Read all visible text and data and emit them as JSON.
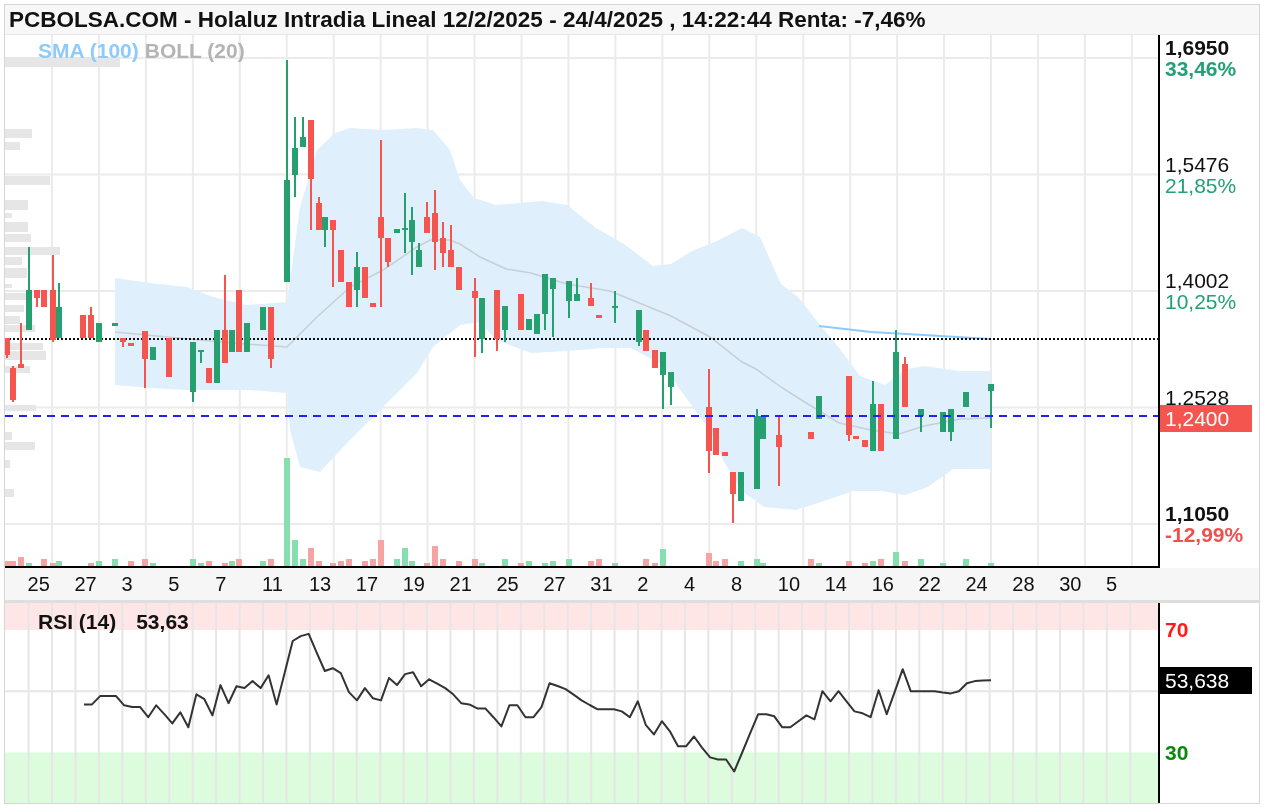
{
  "header": {
    "title": "PCBOLSA.COM - Holaluz Intradia Lineal 12/2/2025 - 24/4/2025 , 14:22:44 Renta: -7,46%"
  },
  "price_chart": {
    "legend": [
      {
        "label": "SMA (100)",
        "color": "#90caf9"
      },
      {
        "label": "BOLL (20)",
        "color": "#b4b4b4"
      }
    ],
    "price_axis": [
      {
        "kind": "high",
        "price": "1,6950",
        "change": "33,46%"
      },
      {
        "kind": "level",
        "price": "1,5476",
        "change": "21,85%"
      },
      {
        "kind": "level",
        "price": "1,4002",
        "change": "10,25%"
      },
      {
        "kind": "level",
        "price": "1,2528"
      },
      {
        "kind": "low",
        "price": "1,1050",
        "change": "-12,99%"
      }
    ],
    "last_price": "1,2400",
    "date_axis": [
      "25",
      "27",
      "3",
      "5",
      "7",
      "11",
      "13",
      "17",
      "19",
      "21",
      "25",
      "27",
      "31",
      "2",
      "4",
      "8",
      "10",
      "14",
      "16",
      "22",
      "24",
      "28",
      "30",
      "5"
    ]
  },
  "rsi": {
    "reading": "53,63",
    "last_value": "53,638",
    "chart_data": {
      "type": "line",
      "title": "RSI (14)",
      "grid": true,
      "ylim": [
        13.5,
        78.8
      ],
      "yticks": [
        30,
        70
      ],
      "series": [
        {
          "color": "#333333",
          "values": [
            45.7,
            45.7,
            48.4,
            48.4,
            48.4,
            45.4,
            44.8,
            44.8,
            41.5,
            45.4,
            42.5,
            39.5,
            43.1,
            38.2,
            49.0,
            47.4,
            42.1,
            52.0,
            46.1,
            51.6,
            51.0,
            53.3,
            51.0,
            55.2,
            45.7,
            56.0,
            66.4,
            68.0,
            68.7,
            62.5,
            56.6,
            57.5,
            55.9,
            49.7,
            47.0,
            51.0,
            47.7,
            47.0,
            54.3,
            52.0,
            55.6,
            56.2,
            51.6,
            53.9,
            52.5,
            51.0,
            49.0,
            46.1,
            45.7,
            44.4,
            44.4,
            41.5,
            38.5,
            45.4,
            45.4,
            41.5,
            41.5,
            44.8,
            52.6,
            51.7,
            50.7,
            48.9,
            47.0,
            45.5,
            44.1,
            44.1,
            44.1,
            43.4,
            41.5,
            46.7,
            38.9,
            35.9,
            40.2,
            36.9,
            32.0,
            32.0,
            35.2,
            31.6,
            28.4,
            27.7,
            27.7,
            23.8,
            30.0,
            36.3,
            42.5,
            42.5,
            41.8,
            38.2,
            38.2,
            40.2,
            42.1,
            40.8,
            50.0,
            46.7,
            50.0,
            46.7,
            43.4,
            42.8,
            41.5,
            50.3,
            42.5,
            49.8,
            57.2,
            50.0,
            50.0,
            50.0,
            50.0,
            49.6,
            49.3,
            50.0,
            52.6,
            53.3,
            53.5,
            53.6
          ]
        }
      ]
    }
  }
}
